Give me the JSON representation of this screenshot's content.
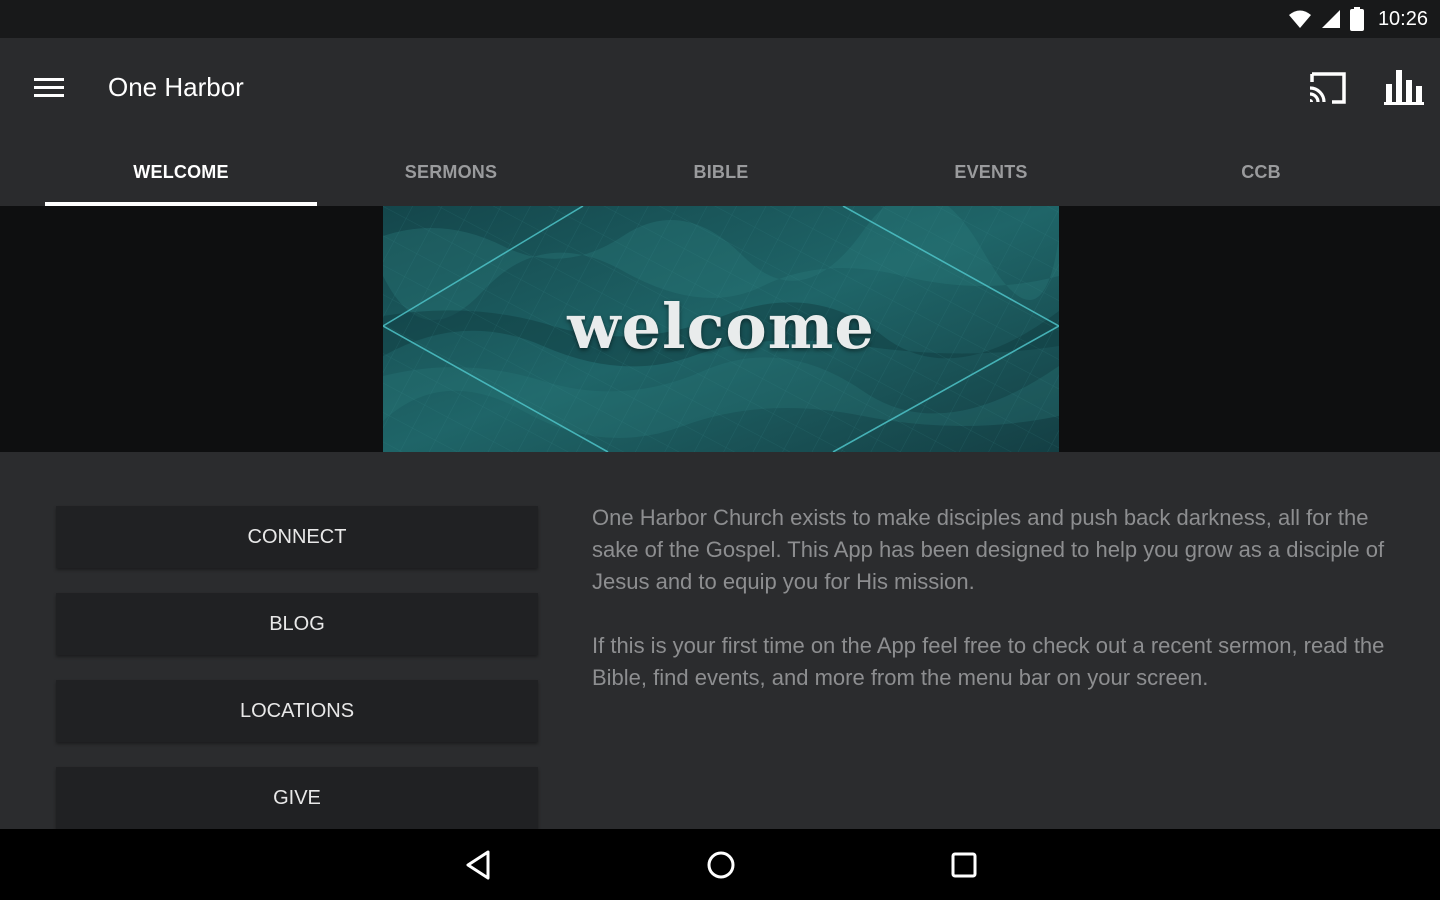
{
  "status_bar": {
    "time": "10:26",
    "icons": [
      "wifi-icon",
      "signal-icon",
      "battery-icon"
    ]
  },
  "app_bar": {
    "title": "One Harbor",
    "icons": [
      "menu-icon",
      "cast-icon",
      "stats-icon"
    ]
  },
  "tabs": [
    {
      "label": "WELCOME",
      "active": true
    },
    {
      "label": "SERMONS",
      "active": false
    },
    {
      "label": "BIBLE",
      "active": false
    },
    {
      "label": "EVENTS",
      "active": false
    },
    {
      "label": "CCB",
      "active": false
    }
  ],
  "banner": {
    "text": "welcome"
  },
  "buttons": [
    {
      "label": "CONNECT"
    },
    {
      "label": "BLOG"
    },
    {
      "label": "LOCATIONS"
    },
    {
      "label": "GIVE"
    }
  ],
  "description": {
    "paragraph1": "One Harbor Church exists to make disciples and push back darkness, all for the sake of the Gospel. This App has been designed to help you grow as a disciple of Jesus and to equip you for His mission.",
    "paragraph2": "If this is your first time on the App feel free to check out a recent sermon, read the Bible, find events, and more from the menu bar on your screen."
  },
  "nav_bar": {
    "icons": [
      "back-icon",
      "home-icon",
      "recents-icon"
    ]
  },
  "colors": {
    "background": "#2b2c2e",
    "app_bar": "#2a2b2d",
    "banner_teal": "#1e5f63",
    "tab_active": "#ffffff",
    "tab_inactive": "#9a9b9d"
  }
}
